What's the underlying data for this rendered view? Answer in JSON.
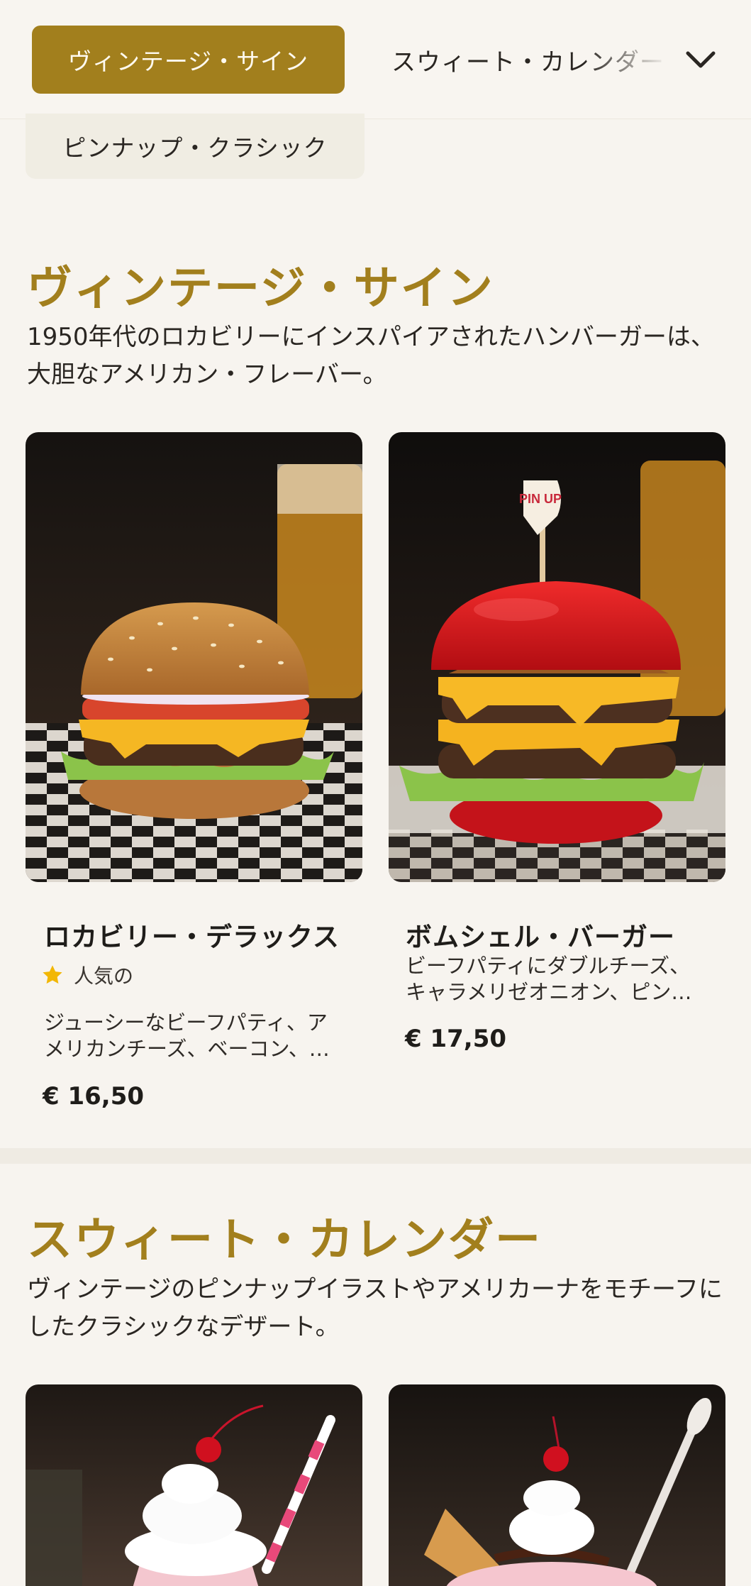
{
  "nav": {
    "active_category": "ヴィンテージ・サイン",
    "next_category": "スウィート・カレンダー",
    "chip_category": "ピンナップ・クラシック",
    "dropdown_icon": "chevron-down-icon"
  },
  "sections": [
    {
      "title": "ヴィンテージ・サイン",
      "description": "1950年代のロカビリーにインスパイアされたハンバーガーは、大胆なアメリカン・フレーバー。",
      "products": [
        {
          "name": "ロカビリー・デラックス",
          "badge": "人気の",
          "badge_icon": "star-icon",
          "description": "ジューシーなビーフパティ、アメリカンチーズ、ベーコン、…",
          "price": "€ 16,50"
        },
        {
          "name": "ボムシェル・バーガー",
          "description": "ビーフパティにダブルチーズ、キャラメリゼオニオン、ピン…",
          "price": "€ 17,50",
          "flag_text": "PIN UP"
        }
      ]
    },
    {
      "title": "スウィート・カレンダー",
      "description": "ヴィンテージのピンナップイラストやアメリカーナをモチーフにしたクラシックなデザート。"
    }
  ],
  "colors": {
    "accent": "#a27f1d",
    "background": "#f7f4ef",
    "star": "#f2b705"
  }
}
